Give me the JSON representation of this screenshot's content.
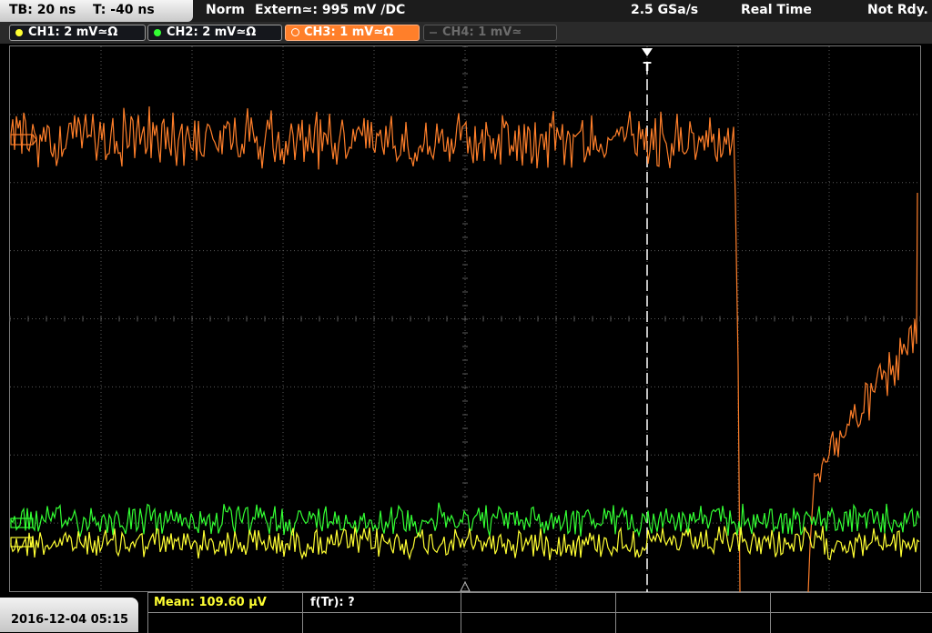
{
  "header": {
    "timebase": "TB: 20 ns",
    "trigger_offset": "T: -40 ns",
    "trigger_mode": "Norm",
    "trigger_source": "Extern≃: 995 mV ∕DC",
    "sample_rate": "2.5 GSa/s",
    "acq_mode": "Real Time",
    "status": "Not Rdy."
  },
  "channels": [
    {
      "label": "CH1: 2 mV≃Ω",
      "color": "#ffff33",
      "state": "on"
    },
    {
      "label": "CH2: 2 mV≃Ω",
      "color": "#33ff33",
      "state": "on"
    },
    {
      "label": "CH3: 1 mV≃Ω",
      "color": "#ff7f2a",
      "state": "selected"
    },
    {
      "label": "CH4: 1 mV≃",
      "color": "#666666",
      "state": "off"
    }
  ],
  "marker_labels": {
    "trigger": "T"
  },
  "footer": {
    "datetime": "2016-12-04 05:15",
    "measurements": [
      {
        "label": "Mean: 109.60 µV",
        "color": "#ffff33"
      },
      {
        "label": "f(Tr): ?",
        "color": "#ffffff"
      }
    ]
  },
  "colors": {
    "ch1": "#ffff33",
    "ch2": "#33ff33",
    "ch3": "#ff7f2a",
    "grid": "#5a5a5a"
  }
}
